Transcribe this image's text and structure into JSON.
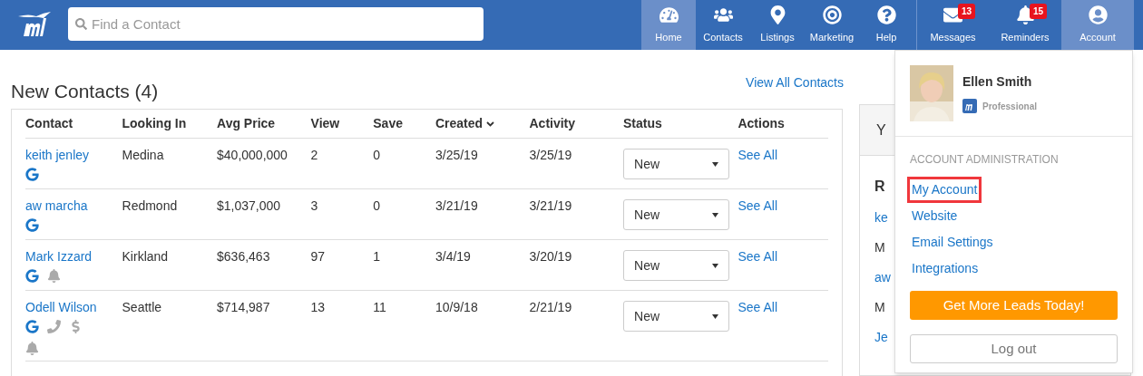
{
  "search": {
    "placeholder": "Find a Contact"
  },
  "nav": [
    {
      "label": "Home",
      "selected": true
    },
    {
      "label": "Contacts",
      "selected": false
    },
    {
      "label": "Listings",
      "selected": false
    },
    {
      "label": "Marketing",
      "selected": false
    },
    {
      "label": "Help",
      "selected": false
    },
    {
      "label": "Messages",
      "badge": "13",
      "selected": false
    },
    {
      "label": "Reminders",
      "badge": "15",
      "selected": false
    },
    {
      "label": "Account",
      "selected": true
    }
  ],
  "contacts": {
    "title": "New Contacts (4)",
    "view_all": "View All Contacts",
    "columns": [
      {
        "label": "Contact",
        "sorted": false
      },
      {
        "label": "Looking In",
        "sorted": false
      },
      {
        "label": "Avg Price",
        "sorted": false
      },
      {
        "label": "View",
        "sorted": false
      },
      {
        "label": "Save",
        "sorted": false
      },
      {
        "label": "Created",
        "sorted": true
      },
      {
        "label": "Activity",
        "sorted": false
      },
      {
        "label": "Status",
        "sorted": false
      },
      {
        "label": "Actions",
        "sorted": false
      }
    ],
    "rows": [
      {
        "name": "keith jenley",
        "icons": [
          {
            "kind": "google"
          }
        ],
        "looking_in": "Medina",
        "avg_price": "$40,000,000",
        "view": "2",
        "save": "0",
        "created": "3/25/19",
        "activity": "3/25/19",
        "status": "New",
        "action": "See All"
      },
      {
        "name": "aw marcha",
        "icons": [
          {
            "kind": "google"
          }
        ],
        "looking_in": "Redmond",
        "avg_price": "$1,037,000",
        "view": "3",
        "save": "0",
        "created": "3/21/19",
        "activity": "3/21/19",
        "status": "New",
        "action": "See All"
      },
      {
        "name": "Mark Izzard",
        "icons": [
          {
            "kind": "google"
          },
          {
            "kind": "bell"
          }
        ],
        "looking_in": "Kirkland",
        "avg_price": "$636,463",
        "view": "97",
        "save": "1",
        "created": "3/4/19",
        "activity": "3/20/19",
        "status": "New",
        "action": "See All"
      },
      {
        "name": "Odell Wilson",
        "icons": [
          {
            "kind": "google"
          },
          {
            "kind": "phone"
          },
          {
            "kind": "dollar"
          },
          {
            "kind": "bell"
          }
        ],
        "looking_in": "Seattle",
        "avg_price": "$714,987",
        "view": "13",
        "save": "11",
        "created": "10/9/18",
        "activity": "2/21/19",
        "status": "New",
        "action": "See All"
      }
    ]
  },
  "side_panel": {
    "heading": "Y",
    "subheading": "R",
    "items": [
      "ke",
      "M",
      "aw",
      "M",
      "Je"
    ]
  },
  "account_menu": {
    "name": "Ellen Smith",
    "plan": "Professional",
    "section": "ACCOUNT ADMINISTRATION",
    "items": [
      {
        "label": "My Account",
        "highlighted": true
      },
      {
        "label": "Website",
        "highlighted": false
      },
      {
        "label": "Email Settings",
        "highlighted": false
      },
      {
        "label": "Integrations",
        "highlighted": false
      }
    ],
    "cta": "Get More Leads Today!",
    "logout": "Log out"
  }
}
